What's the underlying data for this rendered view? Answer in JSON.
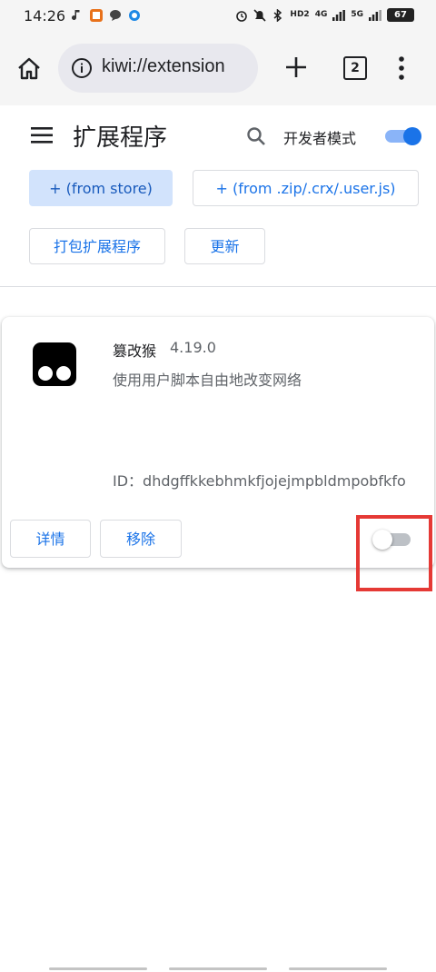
{
  "status_bar": {
    "time": "14:26",
    "network_labels": [
      "HD2",
      "4G",
      "5G"
    ],
    "battery": "67"
  },
  "toolbar": {
    "url": "kiwi://extension",
    "tab_count": "2"
  },
  "header": {
    "title": "扩展程序",
    "developer_mode_label": "开发者模式",
    "developer_mode_on": true
  },
  "actions": {
    "from_store": "+ (from store)",
    "from_zip": "+ (from .zip/.crx/.user.js)",
    "pack": "打包扩展程序",
    "update": "更新"
  },
  "extension": {
    "name": "篡改猴",
    "version": "4.19.0",
    "description": "使用用户脚本自由地改变网络",
    "id": "ID：dhdgffkkebhmkfjojejmpbldmpobfkfo",
    "details_label": "详情",
    "remove_label": "移除",
    "enabled": false
  },
  "colors": {
    "accent": "#1a73e8",
    "highlight": "#e53935"
  }
}
